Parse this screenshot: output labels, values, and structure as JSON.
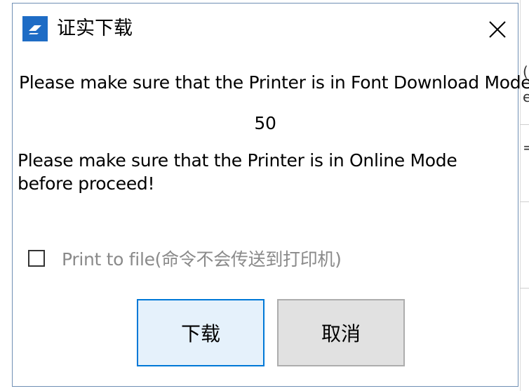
{
  "dialog": {
    "title": "证实下载",
    "message_font_mode": "Please make sure that the Printer is in Font Download Mode",
    "progress_value": "50",
    "message_online_mode": "Please make sure that the Printer is in Online Mode before proceed!",
    "print_to_file_label": "Print to file(命令不会传送到打印机)",
    "print_to_file_checked": false,
    "download_button_label": "下载",
    "cancel_button_label": "取消"
  },
  "background_window": {
    "fragments": [
      "(",
      "e",
      "="
    ]
  },
  "colors": {
    "accent": "#0078d7",
    "dialog_border": "#6f8fb4",
    "icon_blue": "#1e6cc5",
    "disabled_text": "#8a8a8a"
  }
}
